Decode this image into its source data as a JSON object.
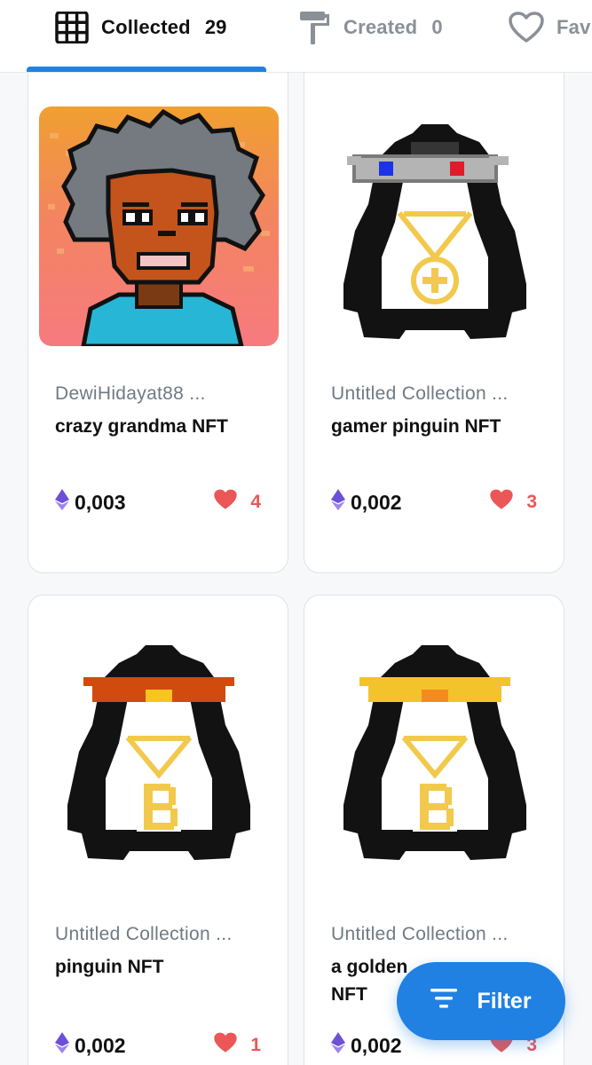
{
  "tabs": [
    {
      "label": "Collected",
      "count": "29",
      "icon": "grid-icon",
      "active": true
    },
    {
      "label": "Created",
      "count": "0",
      "icon": "paint-roller-icon",
      "active": false
    },
    {
      "label": "Fav",
      "icon": "heart-outline-icon",
      "active": false
    }
  ],
  "cards": [
    {
      "collection": "DewiHidayat88 ...",
      "name": "crazy grandma NFT",
      "price": "0,003",
      "likes": "4",
      "image": "pixel-grandma-image"
    },
    {
      "collection": "Untitled Collection ...",
      "name": "gamer pinguin NFT",
      "price": "0,002",
      "likes": "3",
      "image": "pixel-penguin-3d-glasses-image"
    },
    {
      "collection": "Untitled Collection ...",
      "name": "pinguin NFT",
      "price": "0,002",
      "likes": "1",
      "image": "pixel-penguin-orange-glasses-image"
    },
    {
      "collection": "Untitled Collection ...",
      "name": "a golden NFT",
      "price": "0,002",
      "likes": "3",
      "image": "pixel-penguin-gold-glasses-image"
    }
  ],
  "fab": {
    "label": "Filter",
    "icon": "filter-lines-icon"
  },
  "colors": {
    "accent": "#2081e2",
    "heart": "#eb5757",
    "eth": "#6d4fd8",
    "muted": "#707a83"
  }
}
